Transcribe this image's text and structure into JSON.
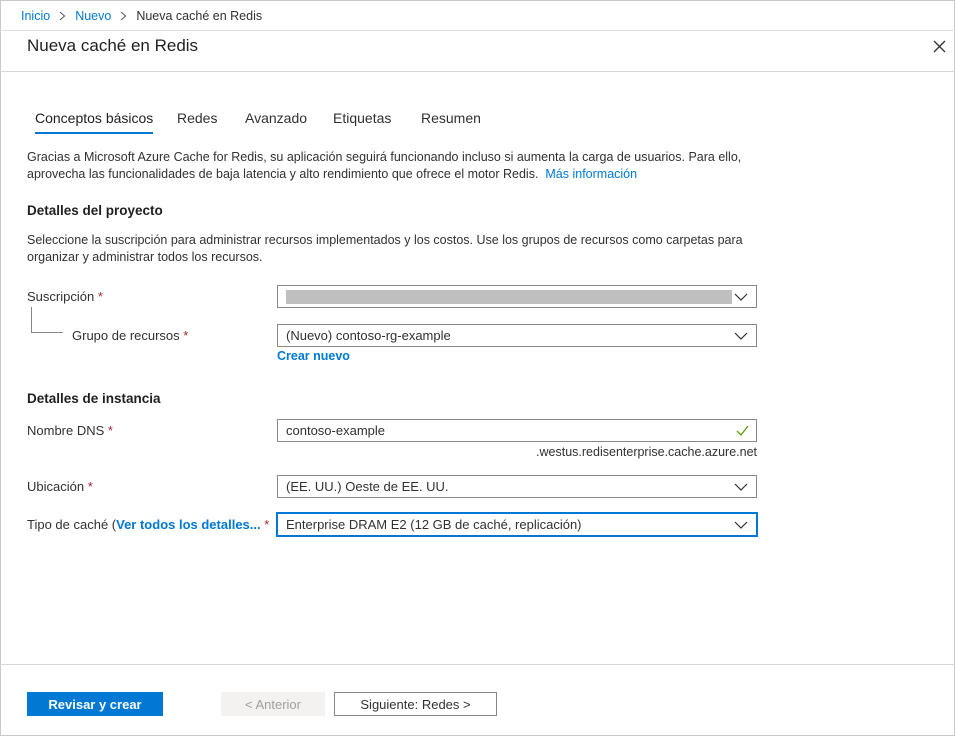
{
  "breadcrumb": {
    "items": [
      "Inicio",
      "Nuevo"
    ],
    "current": "Nueva caché en Redis"
  },
  "header": {
    "title": "Nueva caché en Redis"
  },
  "tabs": [
    {
      "label": "Conceptos básicos",
      "active": true
    },
    {
      "label": "Redes",
      "active": false
    },
    {
      "label": "Avanzado",
      "active": false
    },
    {
      "label": "Etiquetas",
      "active": false
    },
    {
      "label": "Resumen",
      "active": false
    }
  ],
  "intro": {
    "text": "Gracias a Microsoft Azure Cache for Redis, su aplicación seguirá funcionando incluso si aumenta la carga de usuarios. Para ello, aprovecha las funcionalidades de baja latencia y alto rendimiento que ofrece el motor Redis.",
    "link": "Más información"
  },
  "project": {
    "title": "Detalles del proyecto",
    "description": "Seleccione la suscripción para administrar recursos implementados y los costos. Use los grupos de recursos como carpetas para organizar y administrar todos los recursos.",
    "subscription_label": "Suscripción",
    "resource_group_label": "Grupo de recursos",
    "resource_group_value": "(Nuevo) contoso-rg-example",
    "create_new": "Crear nuevo"
  },
  "instance": {
    "title": "Detalles de instancia",
    "dns_label": "Nombre DNS",
    "dns_value": "contoso-example",
    "dns_suffix": ".westus.redisenterprise.cache.azure.net",
    "location_label": "Ubicación",
    "location_value": "(EE. UU.) Oeste de EE. UU.",
    "cache_type_label_prefix": "Tipo de caché (",
    "cache_type_link": "Ver todos los detalles...",
    "cache_type_value": "Enterprise DRAM E2 (12 GB de caché, replicación)"
  },
  "required_marker": "*",
  "footer": {
    "review_create": "Revisar y crear",
    "previous": "< Anterior",
    "next": "Siguiente: Redes >"
  },
  "colors": {
    "accent": "#0078d4",
    "required": "#a4262c",
    "valid": "#57a300"
  },
  "icons": [
    "chevron-right-icon",
    "close-icon",
    "chevron-down-icon",
    "checkmark-icon"
  ]
}
